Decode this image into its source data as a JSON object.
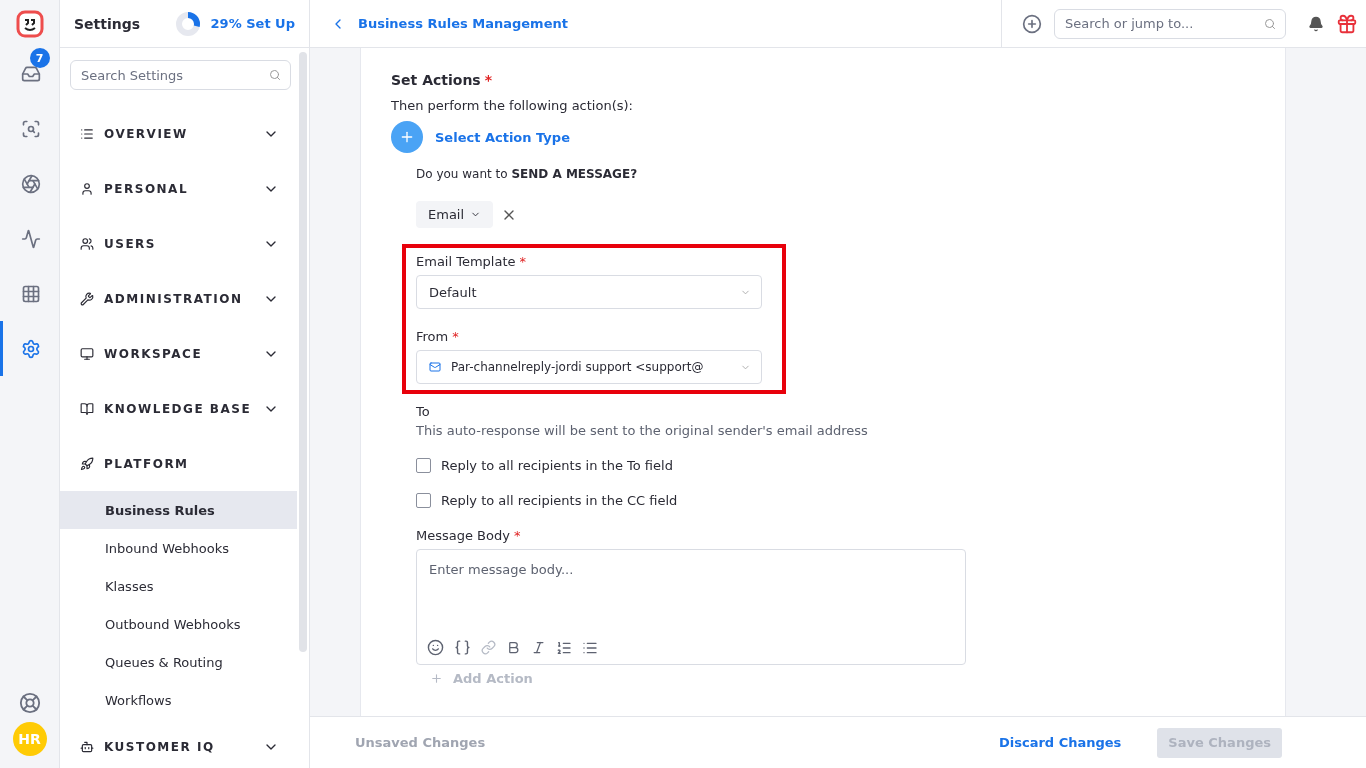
{
  "rail": {
    "inbox_badge": "7",
    "avatar": "HR"
  },
  "sidebar": {
    "title": "Settings",
    "setup": {
      "label": "29% Set Up",
      "level": 0.29
    },
    "search": {
      "placeholder": "Search Settings"
    },
    "sections": [
      {
        "label": "OVERVIEW",
        "expanded": false
      },
      {
        "label": "PERSONAL",
        "expanded": false
      },
      {
        "label": "USERS",
        "expanded": false
      },
      {
        "label": "ADMINISTRATION",
        "expanded": false
      },
      {
        "label": "WORKSPACE",
        "expanded": false
      },
      {
        "label": "KNOWLEDGE BASE",
        "expanded": false
      },
      {
        "label": "PLATFORM",
        "expanded": true,
        "children": [
          {
            "label": "Business Rules",
            "selected": true
          },
          {
            "label": "Inbound Webhooks",
            "selected": false
          },
          {
            "label": "Klasses",
            "selected": false
          },
          {
            "label": "Outbound Webhooks",
            "selected": false
          },
          {
            "label": "Queues & Routing",
            "selected": false
          },
          {
            "label": "Workflows",
            "selected": false
          }
        ]
      },
      {
        "label": "KUSTOMER IQ",
        "expanded": false
      }
    ]
  },
  "topbar": {
    "title": "Business Rules Management",
    "search": {
      "placeholder": "Search or jump to..."
    }
  },
  "form": {
    "heading": "Set Actions",
    "required_mark": "*",
    "subheading": "Then perform the following action(s):",
    "select_action": "Select Action Type",
    "question": "Do you want to **SEND A MESSAGE?**",
    "channel": "Email",
    "email_template": {
      "label": "Email Template",
      "required_mark": "*",
      "value": "Default"
    },
    "from": {
      "label": "From",
      "required_mark": "*",
      "value": "Par-channelreply-jordi support <support@"
    },
    "to": {
      "label": "To",
      "note": "This auto-response will be sent to the original sender's email address"
    },
    "checkboxes": [
      {
        "label": "Reply to all recipients in the To field",
        "checked": false
      },
      {
        "label": "Reply to all recipients in the CC field",
        "checked": false
      }
    ],
    "message_body": {
      "label": "Message Body",
      "required_mark": "*",
      "placeholder": "Enter message body..."
    },
    "add_action": "Add Action"
  },
  "footer": {
    "status": "Unsaved Changes",
    "discard": "Discard Changes",
    "save": {
      "label": "Save Changes",
      "disabled": true
    }
  }
}
